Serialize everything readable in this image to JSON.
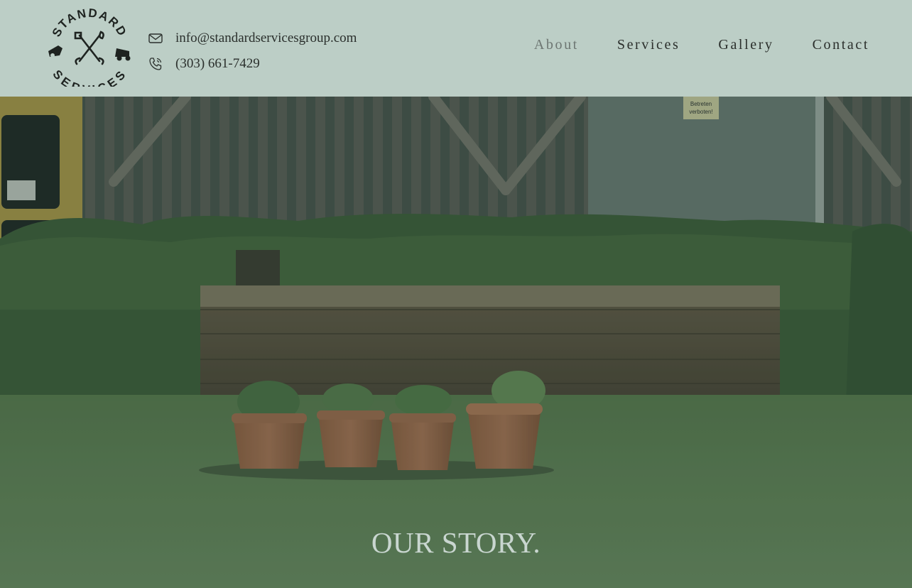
{
  "header": {
    "logo_text_top": "STANDARD",
    "logo_text_bottom": "SERVICES",
    "email": "info@standardservicesgroup.com",
    "phone": "(303) 661-7429",
    "email_icon": "envelope-icon",
    "phone_icon": "phone-icon"
  },
  "nav": {
    "items": [
      {
        "label": "About",
        "active": true
      },
      {
        "label": "Services",
        "active": false
      },
      {
        "label": "Gallery",
        "active": false
      },
      {
        "label": "Contact",
        "active": false
      }
    ]
  },
  "hero": {
    "title": "OUR STORY.",
    "sign_line1": "Betreten",
    "sign_line2": "verboten!"
  },
  "colors": {
    "header_bg": "#bccec6",
    "text_dark": "#2a2e2b",
    "nav_active": "#6d7672",
    "hero_title": "#c9d6d0"
  }
}
